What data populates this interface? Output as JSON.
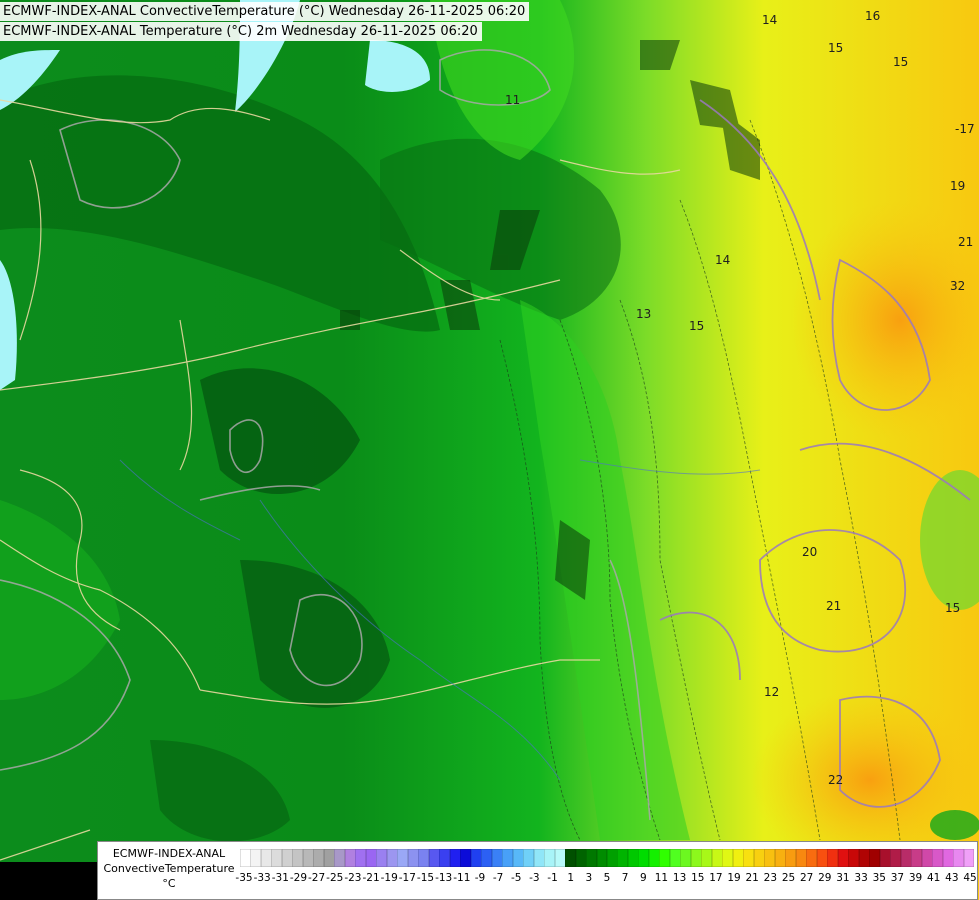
{
  "titles": {
    "line1": "ECMWF-INDEX-ANAL ConvectiveTemperature (°C) Wednesday 26-11-2025 06:20",
    "line2": "ECMWF-INDEX-ANAL Temperature (°C) 2m Wednesday 26-11-2025 06:20"
  },
  "legend": {
    "model": "ECMWF-INDEX-ANAL",
    "variable": "ConvectiveTemperature",
    "unit": "°C",
    "tick_labels": [
      "-35",
      "-33",
      "-31",
      "-29",
      "-27",
      "-25",
      "-23",
      "-21",
      "-19",
      "-17",
      "-15",
      "-13",
      "-11",
      "-9",
      "-7",
      "-5",
      "-3",
      "-1",
      "1",
      "3",
      "5",
      "7",
      "9",
      "11",
      "13",
      "15",
      "17",
      "19",
      "21",
      "23",
      "25",
      "27",
      "29",
      "31",
      "33",
      "35",
      "37",
      "39",
      "41",
      "43",
      "45"
    ],
    "colors": [
      "#ffffff",
      "#f4f4f4",
      "#e8e8e8",
      "#dcdcdc",
      "#d0d0d0",
      "#c4c4c4",
      "#b8b8b8",
      "#acacac",
      "#a0a0a0",
      "#a898c8",
      "#b080e0",
      "#a070f0",
      "#9a66f2",
      "#9a80f0",
      "#9c96f0",
      "#9aa8f6",
      "#8c92f0",
      "#7a82f0",
      "#5858f0",
      "#3a40f0",
      "#2020f0",
      "#0c0cd8",
      "#2040f0",
      "#2c60f4",
      "#3a80f6",
      "#48a0f8",
      "#58b8f8",
      "#70d0f8",
      "#90e6f8",
      "#a8f4f8",
      "#b8fafa",
      "#005000",
      "#006400",
      "#007800",
      "#008c00",
      "#00a000",
      "#00b400",
      "#00c800",
      "#00dc00",
      "#14f000",
      "#30ff00",
      "#50ff20",
      "#6cf820",
      "#8cf81c",
      "#a8f818",
      "#c8f816",
      "#e0f814",
      "#f0f010",
      "#f8e010",
      "#f8d010",
      "#f8c010",
      "#f8b010",
      "#f89c10",
      "#f88810",
      "#f86c10",
      "#f85010",
      "#f03010",
      "#e01010",
      "#c80808",
      "#b00404",
      "#a00000",
      "#a8102c",
      "#b01c48",
      "#b82c68",
      "#c83c88",
      "#d048a8",
      "#d858c8",
      "#e068e0",
      "#e888f0",
      "#f0a0f8"
    ]
  },
  "contour_labels": [
    "14",
    "16",
    "15",
    "15",
    "-17",
    "11",
    "14",
    "19",
    "21",
    "32",
    "13",
    "15",
    "20",
    "21",
    "15",
    "22",
    "12"
  ]
}
